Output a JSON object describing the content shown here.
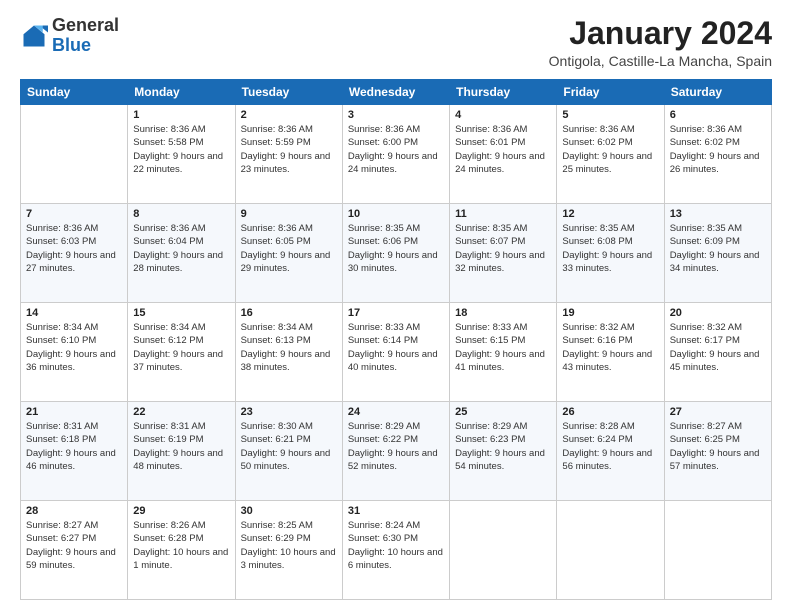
{
  "header": {
    "logo_general": "General",
    "logo_blue": "Blue",
    "month_title": "January 2024",
    "location": "Ontigola, Castille-La Mancha, Spain"
  },
  "weekdays": [
    "Sunday",
    "Monday",
    "Tuesday",
    "Wednesday",
    "Thursday",
    "Friday",
    "Saturday"
  ],
  "weeks": [
    [
      {
        "day": "",
        "sunrise": "",
        "sunset": "",
        "daylight": ""
      },
      {
        "day": "1",
        "sunrise": "Sunrise: 8:36 AM",
        "sunset": "Sunset: 5:58 PM",
        "daylight": "Daylight: 9 hours and 22 minutes."
      },
      {
        "day": "2",
        "sunrise": "Sunrise: 8:36 AM",
        "sunset": "Sunset: 5:59 PM",
        "daylight": "Daylight: 9 hours and 23 minutes."
      },
      {
        "day": "3",
        "sunrise": "Sunrise: 8:36 AM",
        "sunset": "Sunset: 6:00 PM",
        "daylight": "Daylight: 9 hours and 24 minutes."
      },
      {
        "day": "4",
        "sunrise": "Sunrise: 8:36 AM",
        "sunset": "Sunset: 6:01 PM",
        "daylight": "Daylight: 9 hours and 24 minutes."
      },
      {
        "day": "5",
        "sunrise": "Sunrise: 8:36 AM",
        "sunset": "Sunset: 6:02 PM",
        "daylight": "Daylight: 9 hours and 25 minutes."
      },
      {
        "day": "6",
        "sunrise": "Sunrise: 8:36 AM",
        "sunset": "Sunset: 6:02 PM",
        "daylight": "Daylight: 9 hours and 26 minutes."
      }
    ],
    [
      {
        "day": "7",
        "sunrise": "Sunrise: 8:36 AM",
        "sunset": "Sunset: 6:03 PM",
        "daylight": "Daylight: 9 hours and 27 minutes."
      },
      {
        "day": "8",
        "sunrise": "Sunrise: 8:36 AM",
        "sunset": "Sunset: 6:04 PM",
        "daylight": "Daylight: 9 hours and 28 minutes."
      },
      {
        "day": "9",
        "sunrise": "Sunrise: 8:36 AM",
        "sunset": "Sunset: 6:05 PM",
        "daylight": "Daylight: 9 hours and 29 minutes."
      },
      {
        "day": "10",
        "sunrise": "Sunrise: 8:35 AM",
        "sunset": "Sunset: 6:06 PM",
        "daylight": "Daylight: 9 hours and 30 minutes."
      },
      {
        "day": "11",
        "sunrise": "Sunrise: 8:35 AM",
        "sunset": "Sunset: 6:07 PM",
        "daylight": "Daylight: 9 hours and 32 minutes."
      },
      {
        "day": "12",
        "sunrise": "Sunrise: 8:35 AM",
        "sunset": "Sunset: 6:08 PM",
        "daylight": "Daylight: 9 hours and 33 minutes."
      },
      {
        "day": "13",
        "sunrise": "Sunrise: 8:35 AM",
        "sunset": "Sunset: 6:09 PM",
        "daylight": "Daylight: 9 hours and 34 minutes."
      }
    ],
    [
      {
        "day": "14",
        "sunrise": "Sunrise: 8:34 AM",
        "sunset": "Sunset: 6:10 PM",
        "daylight": "Daylight: 9 hours and 36 minutes."
      },
      {
        "day": "15",
        "sunrise": "Sunrise: 8:34 AM",
        "sunset": "Sunset: 6:12 PM",
        "daylight": "Daylight: 9 hours and 37 minutes."
      },
      {
        "day": "16",
        "sunrise": "Sunrise: 8:34 AM",
        "sunset": "Sunset: 6:13 PM",
        "daylight": "Daylight: 9 hours and 38 minutes."
      },
      {
        "day": "17",
        "sunrise": "Sunrise: 8:33 AM",
        "sunset": "Sunset: 6:14 PM",
        "daylight": "Daylight: 9 hours and 40 minutes."
      },
      {
        "day": "18",
        "sunrise": "Sunrise: 8:33 AM",
        "sunset": "Sunset: 6:15 PM",
        "daylight": "Daylight: 9 hours and 41 minutes."
      },
      {
        "day": "19",
        "sunrise": "Sunrise: 8:32 AM",
        "sunset": "Sunset: 6:16 PM",
        "daylight": "Daylight: 9 hours and 43 minutes."
      },
      {
        "day": "20",
        "sunrise": "Sunrise: 8:32 AM",
        "sunset": "Sunset: 6:17 PM",
        "daylight": "Daylight: 9 hours and 45 minutes."
      }
    ],
    [
      {
        "day": "21",
        "sunrise": "Sunrise: 8:31 AM",
        "sunset": "Sunset: 6:18 PM",
        "daylight": "Daylight: 9 hours and 46 minutes."
      },
      {
        "day": "22",
        "sunrise": "Sunrise: 8:31 AM",
        "sunset": "Sunset: 6:19 PM",
        "daylight": "Daylight: 9 hours and 48 minutes."
      },
      {
        "day": "23",
        "sunrise": "Sunrise: 8:30 AM",
        "sunset": "Sunset: 6:21 PM",
        "daylight": "Daylight: 9 hours and 50 minutes."
      },
      {
        "day": "24",
        "sunrise": "Sunrise: 8:29 AM",
        "sunset": "Sunset: 6:22 PM",
        "daylight": "Daylight: 9 hours and 52 minutes."
      },
      {
        "day": "25",
        "sunrise": "Sunrise: 8:29 AM",
        "sunset": "Sunset: 6:23 PM",
        "daylight": "Daylight: 9 hours and 54 minutes."
      },
      {
        "day": "26",
        "sunrise": "Sunrise: 8:28 AM",
        "sunset": "Sunset: 6:24 PM",
        "daylight": "Daylight: 9 hours and 56 minutes."
      },
      {
        "day": "27",
        "sunrise": "Sunrise: 8:27 AM",
        "sunset": "Sunset: 6:25 PM",
        "daylight": "Daylight: 9 hours and 57 minutes."
      }
    ],
    [
      {
        "day": "28",
        "sunrise": "Sunrise: 8:27 AM",
        "sunset": "Sunset: 6:27 PM",
        "daylight": "Daylight: 9 hours and 59 minutes."
      },
      {
        "day": "29",
        "sunrise": "Sunrise: 8:26 AM",
        "sunset": "Sunset: 6:28 PM",
        "daylight": "Daylight: 10 hours and 1 minute."
      },
      {
        "day": "30",
        "sunrise": "Sunrise: 8:25 AM",
        "sunset": "Sunset: 6:29 PM",
        "daylight": "Daylight: 10 hours and 3 minutes."
      },
      {
        "day": "31",
        "sunrise": "Sunrise: 8:24 AM",
        "sunset": "Sunset: 6:30 PM",
        "daylight": "Daylight: 10 hours and 6 minutes."
      },
      {
        "day": "",
        "sunrise": "",
        "sunset": "",
        "daylight": ""
      },
      {
        "day": "",
        "sunrise": "",
        "sunset": "",
        "daylight": ""
      },
      {
        "day": "",
        "sunrise": "",
        "sunset": "",
        "daylight": ""
      }
    ]
  ]
}
